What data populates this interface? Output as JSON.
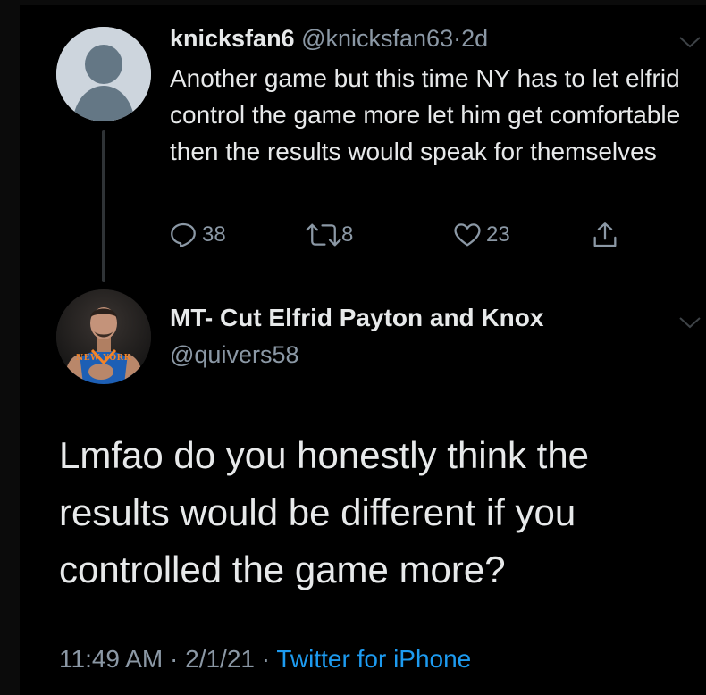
{
  "reply_tweet": {
    "display_name": "knicksfan6",
    "handle": "@knicksfan63",
    "separator": "·",
    "time_ago": "2d",
    "text": "Another game but this time NY has to let elfrid control the game more let him get comfortable then the results would speak for themselves",
    "avatar_icon": "default-profile-icon",
    "actions": {
      "reply_count": "38",
      "retweet_count": "8",
      "like_count": "23"
    }
  },
  "main_tweet": {
    "display_name": "MT- Cut Elfrid Payton and Knox",
    "handle": "@quivers58",
    "avatar_jersey_text": "NEW YORK",
    "text": "Lmfao do you honestly think the results would be different if you controlled the game more?",
    "timestamp_time": "11:49 AM",
    "separator": "·",
    "date": "2/1/21",
    "source": "Twitter for iPhone"
  },
  "colors": {
    "background": "#000000",
    "primary_text": "#e7e9ea",
    "secondary_text": "#8b98a5",
    "link": "#1d9bf0"
  }
}
